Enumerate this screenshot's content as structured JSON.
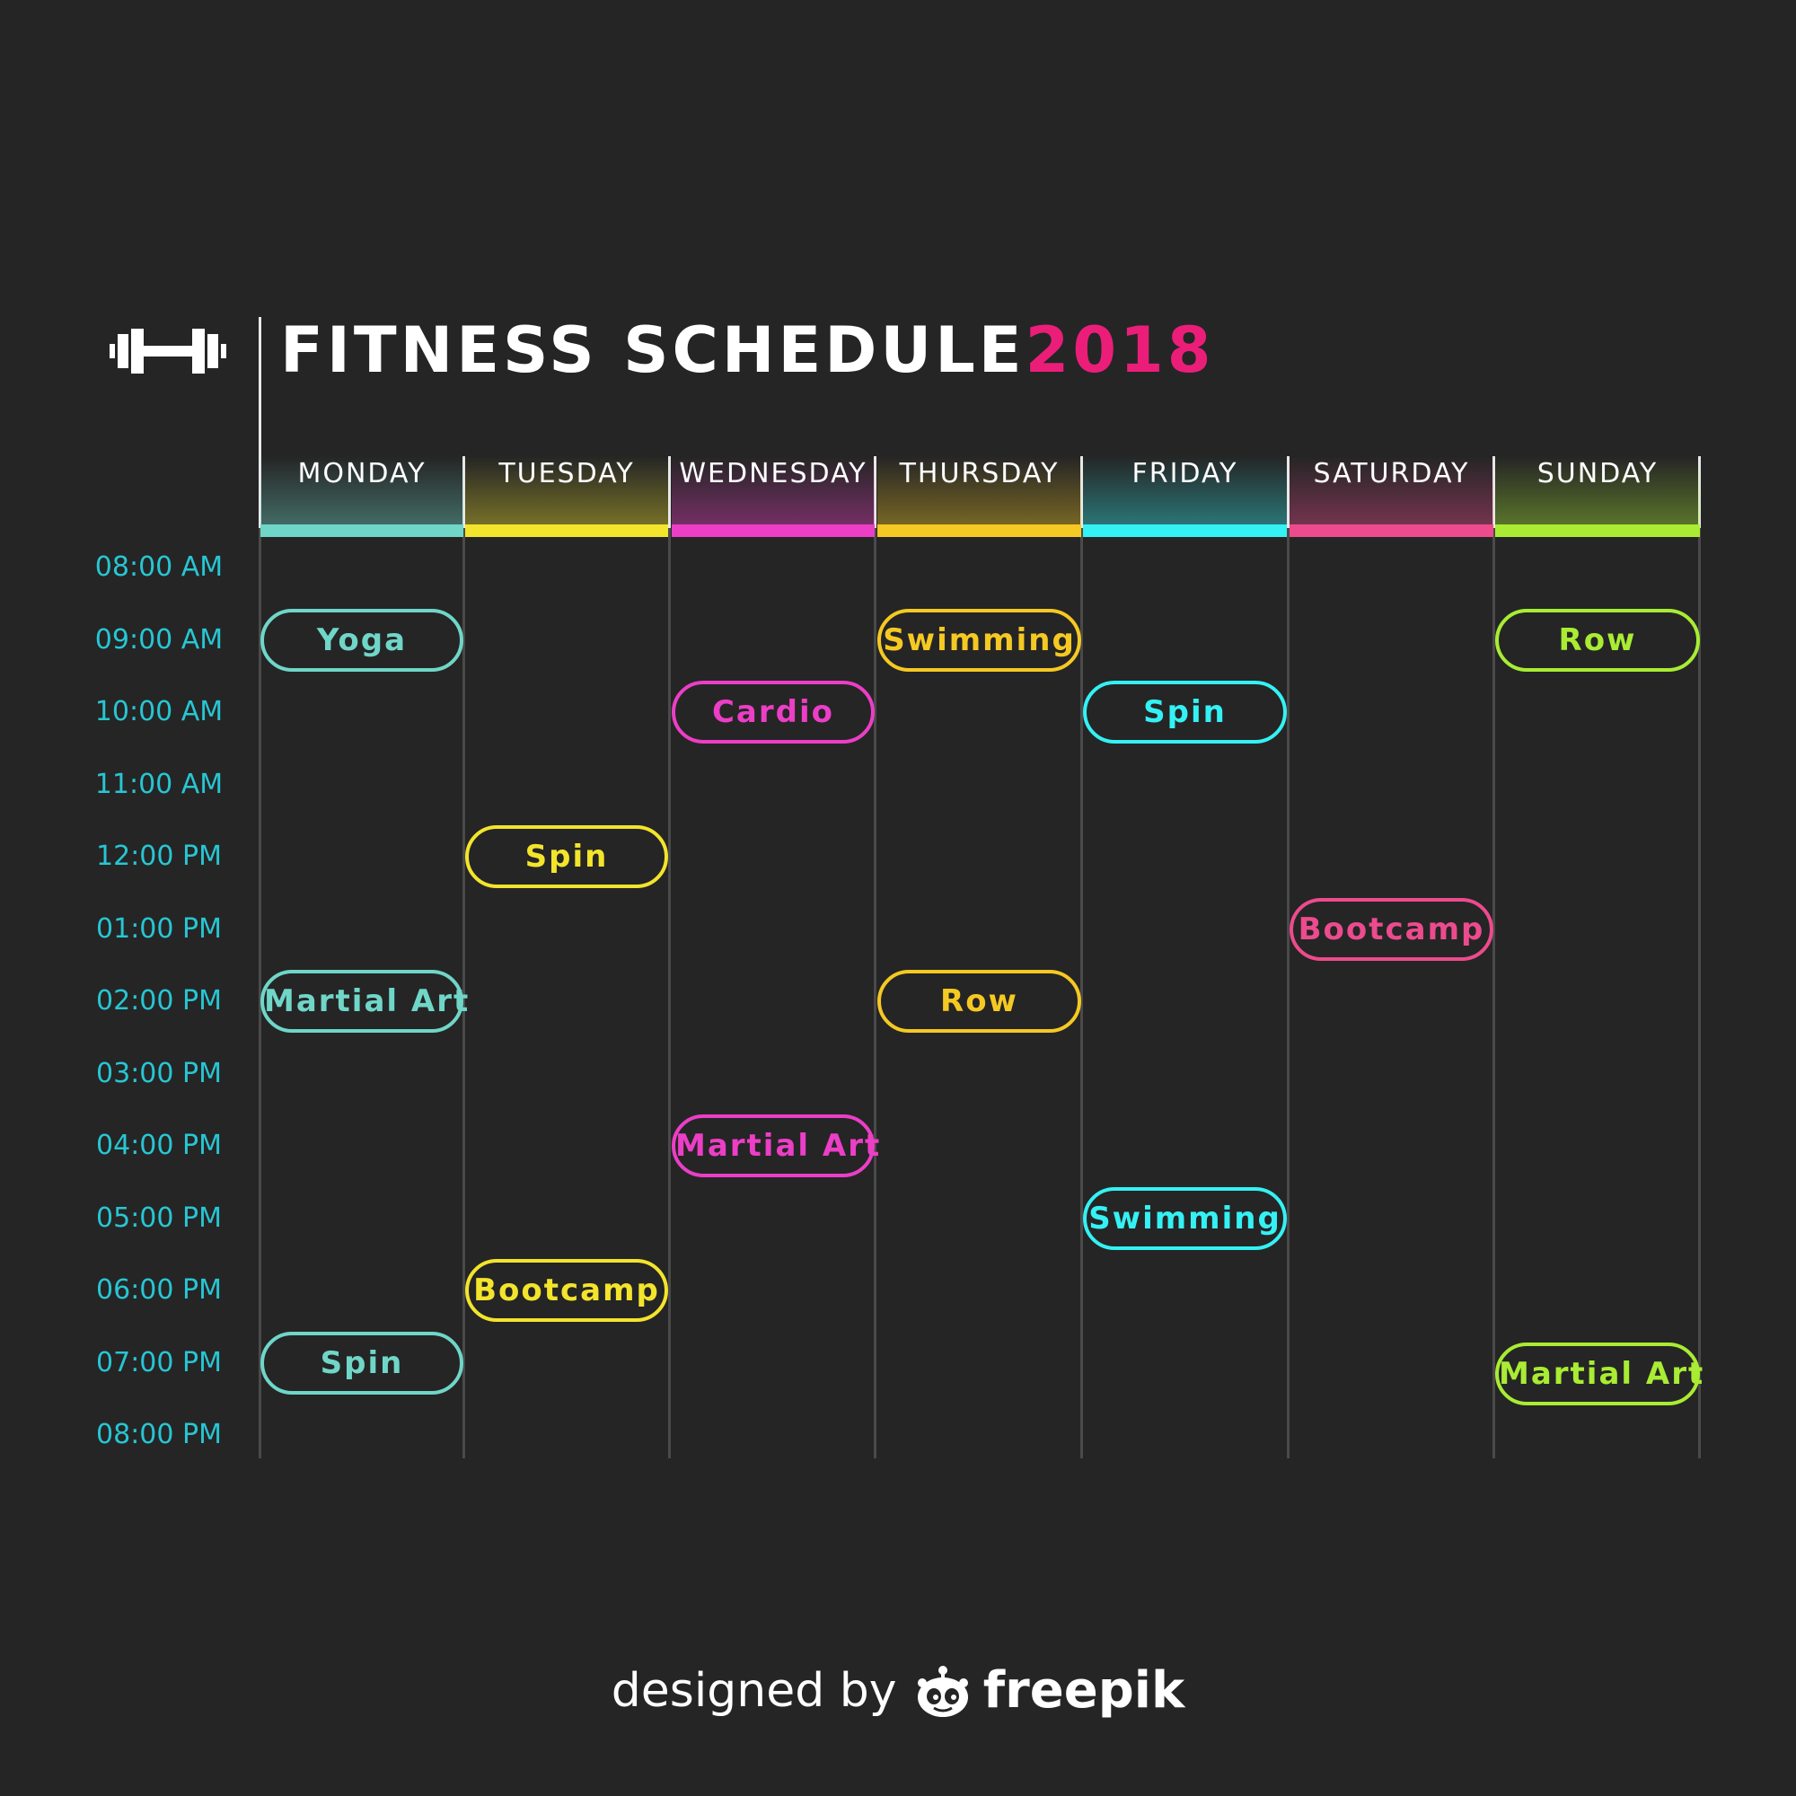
{
  "header": {
    "title": "FITNESS SCHEDULE",
    "year": "2018",
    "icon": "dumbbell-icon"
  },
  "colors": {
    "background": "#252525",
    "title": "#ffffff",
    "year": "#ea1e79",
    "time": "#27c6d3",
    "grid": "#4a4a4a"
  },
  "days": [
    {
      "label": "MONDAY",
      "color": "#6fd6c8"
    },
    {
      "label": "TUESDAY",
      "color": "#f3e42c"
    },
    {
      "label": "WEDNESDAY",
      "color": "#ec3ec6"
    },
    {
      "label": "THURSDAY",
      "color": "#f5c923"
    },
    {
      "label": "FRIDAY",
      "color": "#34f1f4"
    },
    {
      "label": "SATURDAY",
      "color": "#ec4b8d"
    },
    {
      "label": "SUNDAY",
      "color": "#a9ec33"
    }
  ],
  "times": [
    "08:00 AM",
    "09:00 AM",
    "10:00 AM",
    "11:00 AM",
    "12:00 PM",
    "01:00 PM",
    "02:00 PM",
    "03:00 PM",
    "04:00 PM",
    "05:00 PM",
    "06:00 PM",
    "07:00 PM",
    "08:00 PM"
  ],
  "events": [
    {
      "day": 0,
      "slot": 1,
      "label": "Yoga"
    },
    {
      "day": 0,
      "slot": 6,
      "label": "Martial Art"
    },
    {
      "day": 0,
      "slot": 11,
      "label": "Spin"
    },
    {
      "day": 1,
      "slot": 4,
      "label": "Spin"
    },
    {
      "day": 1,
      "slot": 10,
      "label": "Bootcamp"
    },
    {
      "day": 2,
      "slot": 2,
      "label": "Cardio"
    },
    {
      "day": 2,
      "slot": 8,
      "label": "Martial Art"
    },
    {
      "day": 3,
      "slot": 1,
      "label": "Swimming"
    },
    {
      "day": 3,
      "slot": 6,
      "label": "Row"
    },
    {
      "day": 4,
      "slot": 2,
      "label": "Spin"
    },
    {
      "day": 4,
      "slot": 9,
      "label": "Swimming"
    },
    {
      "day": 5,
      "slot": 5,
      "label": "Bootcamp"
    },
    {
      "day": 6,
      "slot": 1,
      "label": "Row"
    },
    {
      "day": 6,
      "slot": 11.15,
      "label": "Martial Art"
    }
  ],
  "credit": {
    "prefix": "designed by",
    "brand": "freepik",
    "icon": "freepik-logo-icon"
  }
}
